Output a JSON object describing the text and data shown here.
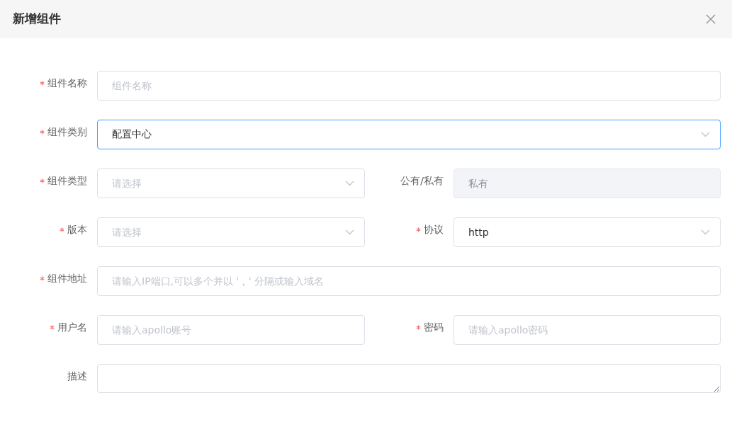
{
  "dialog": {
    "title": "新增组件"
  },
  "rows": [
    {
      "fields": [
        {
          "kind": "input",
          "label": "组件名称",
          "required": true,
          "placeholder": "组件名称",
          "disabled": false,
          "focused": false
        }
      ]
    },
    {
      "fields": [
        {
          "kind": "select",
          "label": "组件类别",
          "required": true,
          "value": "配置中心",
          "disabled": false,
          "focused": true
        }
      ]
    },
    {
      "fields": [
        {
          "kind": "select",
          "label": "组件类型",
          "required": true,
          "placeholder": "请选择",
          "disabled": false,
          "focused": false
        },
        {
          "kind": "input",
          "label": "公有/私有",
          "required": false,
          "placeholder": "私有",
          "disabled": true,
          "focused": false
        }
      ]
    },
    {
      "fields": [
        {
          "kind": "select",
          "label": "版本",
          "required": true,
          "placeholder": "请选择",
          "disabled": false,
          "focused": false
        },
        {
          "kind": "select",
          "label": "协议",
          "required": true,
          "value": "http",
          "disabled": false,
          "focused": false
        }
      ]
    },
    {
      "fields": [
        {
          "kind": "input",
          "label": "组件地址",
          "required": true,
          "placeholder": "请输入IP端口,可以多个并以 ' , ' 分隔或输入域名",
          "disabled": false,
          "focused": false
        }
      ]
    },
    {
      "fields": [
        {
          "kind": "input",
          "label": "用户名",
          "required": true,
          "placeholder": "请输入apollo账号",
          "disabled": false,
          "focused": false
        },
        {
          "kind": "input",
          "label": "密码",
          "required": true,
          "placeholder": "请输入apollo密码",
          "disabled": false,
          "focused": false
        }
      ]
    },
    {
      "fields": [
        {
          "kind": "textarea",
          "label": "描述",
          "required": false,
          "disabled": false,
          "focused": false
        }
      ]
    }
  ]
}
